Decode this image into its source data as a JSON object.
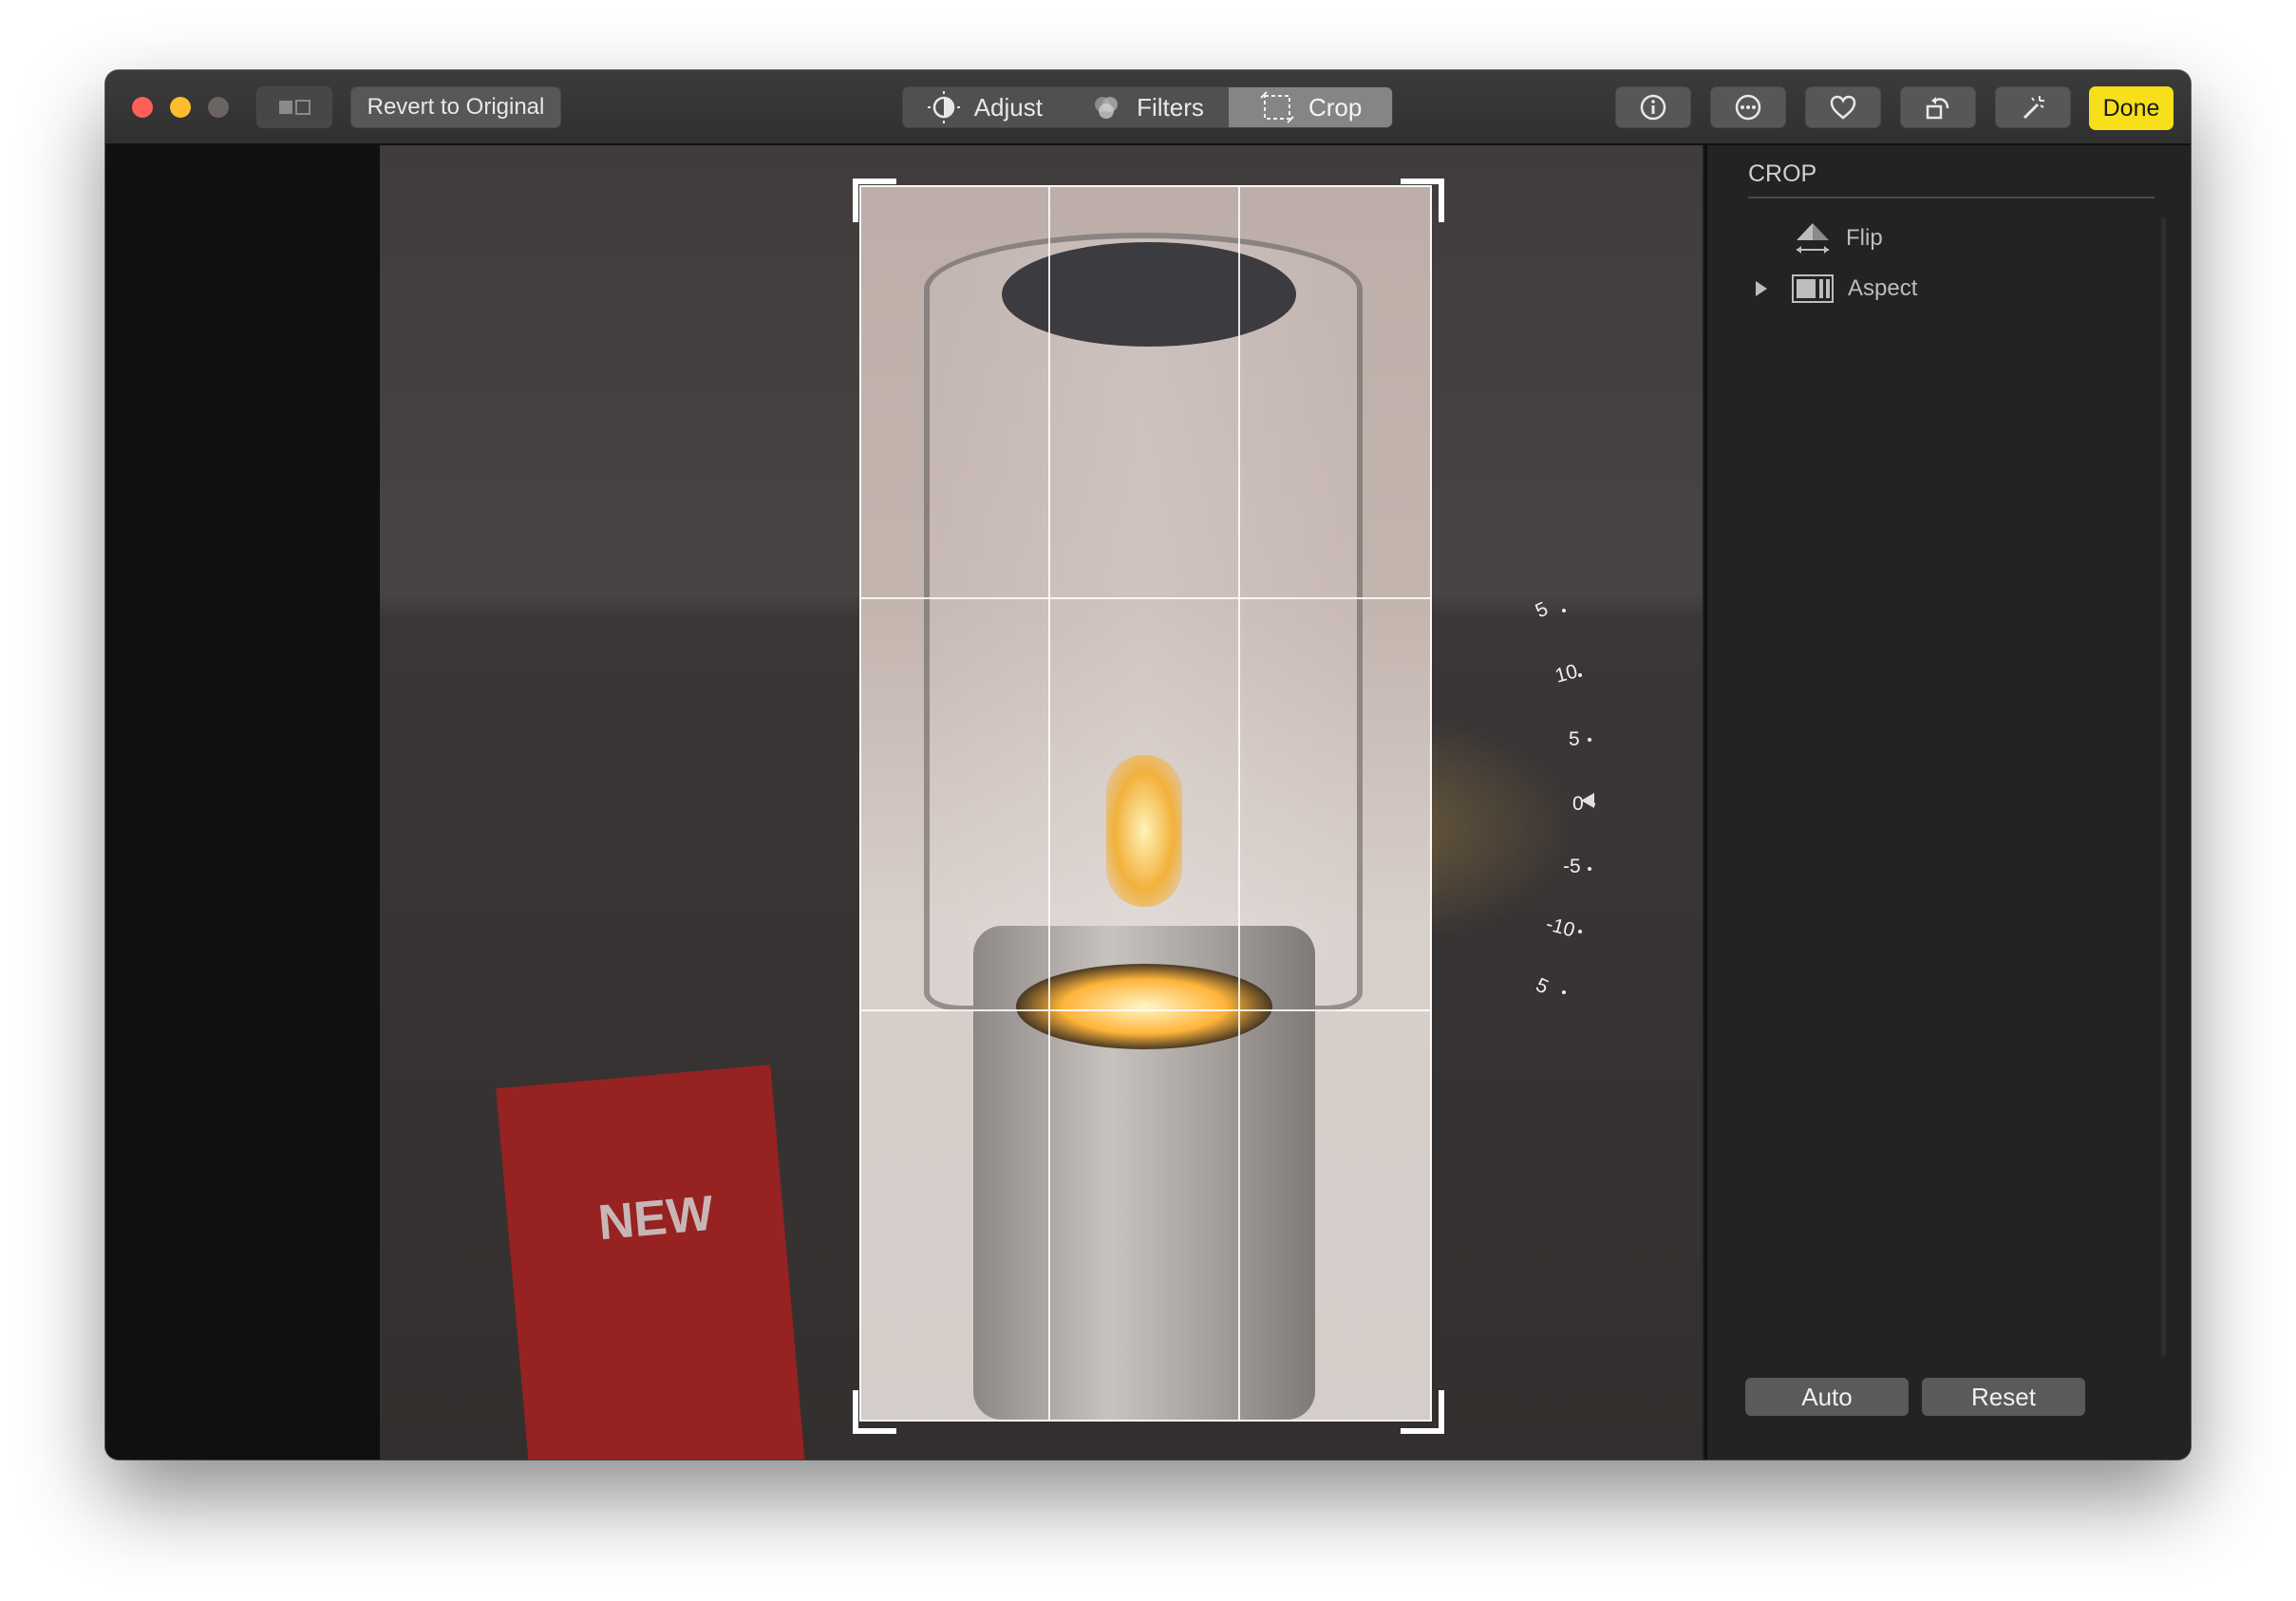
{
  "toolbar": {
    "revert_label": "Revert to Original",
    "tabs": [
      {
        "label": "Adjust",
        "icon": "adjust-icon"
      },
      {
        "label": "Filters",
        "icon": "filters-icon"
      },
      {
        "label": "Crop",
        "icon": "crop-icon"
      }
    ],
    "active_tab": "Crop",
    "done_label": "Done",
    "right_icons": [
      "info-icon",
      "more-icon",
      "heart-icon",
      "rotate-icon",
      "magic-wand-icon"
    ]
  },
  "canvas": {
    "dial_labels": [
      "5",
      "10",
      "5",
      "0",
      "-5",
      "-10",
      "5"
    ],
    "sign_text": "NEW"
  },
  "sidebar": {
    "title": "CROP",
    "items": [
      {
        "label": "Flip",
        "icon": "flip-icon"
      },
      {
        "label": "Aspect",
        "icon": "aspect-icon"
      }
    ],
    "auto_label": "Auto",
    "reset_label": "Reset"
  },
  "colors": {
    "done_bg": "#f7df19",
    "close": "#fe5f57",
    "minimize": "#febc2e"
  }
}
